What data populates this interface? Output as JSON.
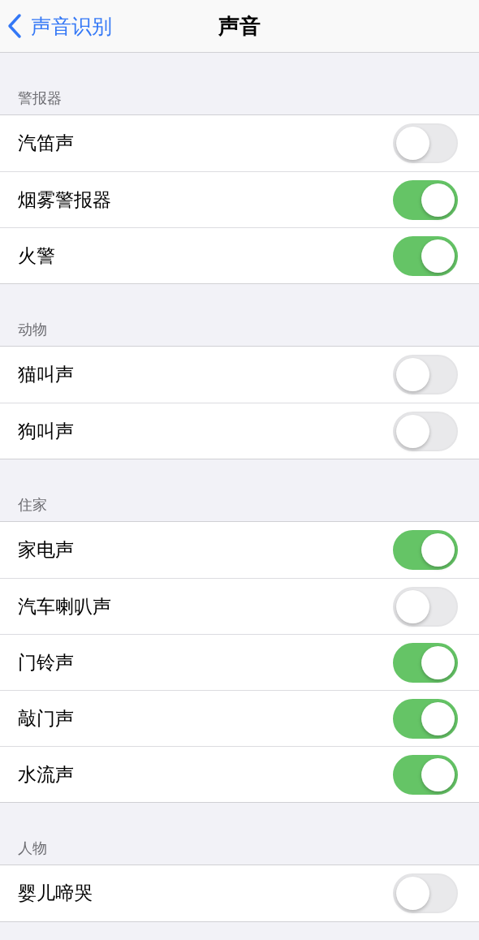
{
  "nav": {
    "back": "声音识别",
    "title": "声音"
  },
  "sections": [
    {
      "header": "警报器",
      "items": [
        {
          "label": "汽笛声",
          "on": false
        },
        {
          "label": "烟雾警报器",
          "on": true
        },
        {
          "label": "火警",
          "on": true
        }
      ]
    },
    {
      "header": "动物",
      "items": [
        {
          "label": "猫叫声",
          "on": false
        },
        {
          "label": "狗叫声",
          "on": false
        }
      ]
    },
    {
      "header": "住家",
      "items": [
        {
          "label": "家电声",
          "on": true
        },
        {
          "label": "汽车喇叭声",
          "on": false
        },
        {
          "label": "门铃声",
          "on": true
        },
        {
          "label": "敲门声",
          "on": true
        },
        {
          "label": "水流声",
          "on": true
        }
      ]
    },
    {
      "header": "人物",
      "items": [
        {
          "label": "婴儿啼哭",
          "on": false
        }
      ]
    }
  ]
}
